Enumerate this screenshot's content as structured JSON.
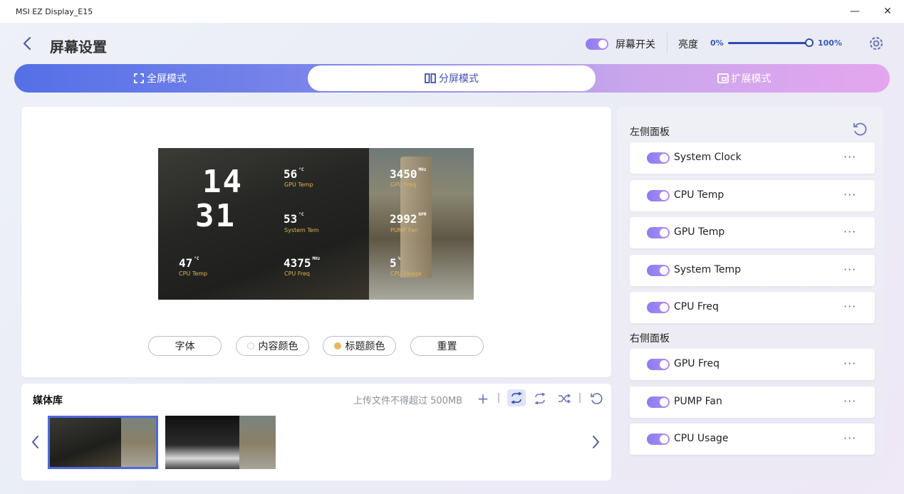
{
  "window": {
    "title": "MSI EZ Display_E15",
    "minimize": "—",
    "close": "✕"
  },
  "header": {
    "page_title": "屏幕设置",
    "screen_switch_label": "屏幕开关",
    "brightness_label": "亮度",
    "brightness_min": "0%",
    "brightness_max": "100%",
    "brightness_value_percent": 100
  },
  "modes": [
    {
      "label": "全屏模式",
      "icon": "fullscreen-icon"
    },
    {
      "label": "分屏模式",
      "icon": "split-icon",
      "active": true
    },
    {
      "label": "扩展模式",
      "icon": "extend-icon"
    }
  ],
  "preview": {
    "clock_hour": "14",
    "clock_min": "31",
    "gpu_temp_value": "56",
    "gpu_temp_unit": "°C",
    "gpu_temp_label": "GPU Temp",
    "sys_temp_value": "53",
    "sys_temp_unit": "°C",
    "sys_temp_label": "System Tem",
    "cpu_temp_value": "47",
    "cpu_temp_unit": "°C",
    "cpu_temp_label": "CPU Temp",
    "cpu_freq_value": "4375",
    "cpu_freq_unit": "MHz",
    "cpu_freq_label": "CPU Freq",
    "gpu_freq_value": "3450",
    "gpu_freq_unit": "MHz",
    "gpu_freq_label": "GPU Freq",
    "pump_value": "2992",
    "pump_unit": "RPM",
    "pump_label": "PUMP Fan",
    "cpu_usage_value": "5",
    "cpu_usage_unit": "%",
    "cpu_usage_label": "CPU Usage"
  },
  "buttons": {
    "font": "字体",
    "content_color": "内容颜色",
    "title_color": "标题颜色",
    "reset": "重置"
  },
  "media": {
    "title": "媒体库",
    "limit_text": "上传文件不得超过 500MB",
    "add": "+"
  },
  "left_panel": {
    "title": "左侧面板",
    "items": [
      {
        "label": "System Clock",
        "enabled": true
      },
      {
        "label": "CPU Temp",
        "enabled": true
      },
      {
        "label": "GPU Temp",
        "enabled": true
      },
      {
        "label": "System Temp",
        "enabled": true
      },
      {
        "label": "CPU Freq",
        "enabled": true
      }
    ]
  },
  "right_panel": {
    "title": "右侧面板",
    "items": [
      {
        "label": "GPU Freq",
        "enabled": true
      },
      {
        "label": "PUMP Fan",
        "enabled": true
      },
      {
        "label": "CPU Usage",
        "enabled": true
      }
    ]
  },
  "more_menu": "···",
  "colors": {
    "accent": "#5470e6",
    "toggle": "#8b7cf0",
    "title_color_dot": "#e4b85c"
  }
}
